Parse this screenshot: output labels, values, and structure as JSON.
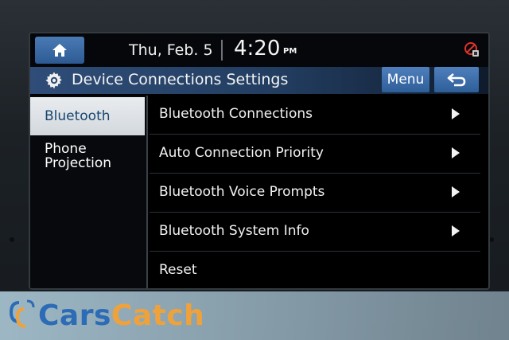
{
  "status_bar": {
    "date": "Thu, Feb. 5",
    "time": "4:20",
    "ampm": "PM",
    "home_icon": "home-icon",
    "status_icon": "mute-phone-icon"
  },
  "title_bar": {
    "icon": "gear-icon",
    "title": "Device Connections Settings",
    "menu_label": "Menu",
    "back_icon": "back-arrow-icon"
  },
  "sidebar": {
    "items": [
      {
        "label": "Bluetooth",
        "active": true
      },
      {
        "label_line1": "Phone",
        "label_line2": "Projection",
        "active": false
      }
    ]
  },
  "list": {
    "items": [
      {
        "label": "Bluetooth Connections",
        "has_chevron": true
      },
      {
        "label": "Auto Connection Priority",
        "has_chevron": true
      },
      {
        "label": "Bluetooth Voice Prompts",
        "has_chevron": true
      },
      {
        "label": "Bluetooth System Info",
        "has_chevron": true
      },
      {
        "label": "Reset",
        "has_chevron": false
      }
    ]
  },
  "watermark": {
    "brand_part1": "Cars",
    "brand_part2": "Catch"
  },
  "colors": {
    "accent_blue": "#2e5e98",
    "active_tab_bg": "#e9ecef",
    "brand_blue": "#2c6bb5",
    "brand_orange": "#f0a23a"
  }
}
